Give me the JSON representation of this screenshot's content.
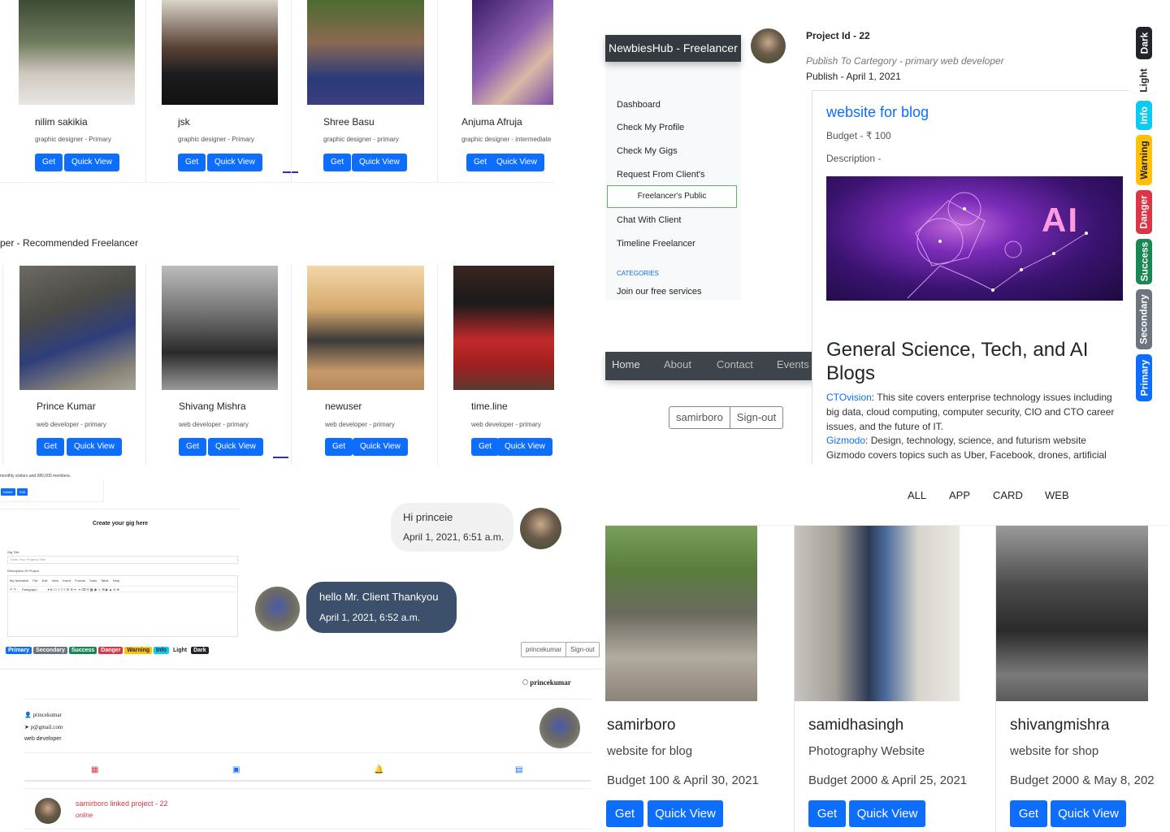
{
  "freelancers_top": [
    {
      "name": "nilim sakikia",
      "role": "graphic designer - Primary"
    },
    {
      "name": "jsk",
      "role": "graphic designer - Primary"
    },
    {
      "name": "Shree Basu",
      "role": "graphic designer - primary"
    },
    {
      "name": "Anjuma Afruja",
      "role": "graphic designer - intermediate"
    }
  ],
  "recommended_heading": "per - Recommended Freelancer",
  "freelancers_recommended": [
    {
      "name": "Prince Kumar",
      "role": "web developer - primary"
    },
    {
      "name": "Shivang Mishra",
      "role": "web developer - primary"
    },
    {
      "name": "newuser",
      "role": "web developer - primary"
    },
    {
      "name": "time.line",
      "role": "web developer - primary"
    }
  ],
  "card_buttons": {
    "get": "Get",
    "quick_view": "Quick View"
  },
  "sidebar": {
    "brand": "NewbiesHub - Freelancer",
    "items": [
      "Dashboard",
      "Check My Profile",
      "Check My Gigs",
      "Request From Client's",
      "Freelancer's Public",
      "Chat With Client",
      "Timeline Freelancer"
    ],
    "categories_label": "CATEGORIES",
    "categories_item": "Join our free services"
  },
  "topnav": {
    "items": [
      "Home",
      "About",
      "Contact",
      "Events"
    ]
  },
  "user_group": {
    "user": "samirboro",
    "signout": "Sign-out"
  },
  "project": {
    "id": "Project Id - 22",
    "category": "Publish To Cartegory - primary web developer",
    "publish": "Publish - April 1, 2021",
    "title": "website for blog",
    "budget": "Budget - ₹ 100",
    "description_label": "Description -",
    "image_text": "AI",
    "blog_heading": "General Science, Tech, and AI Blogs",
    "link1": "CTOvision",
    "text1": ": This site covers enterprise technology issues including big data, cloud computing, computer security, CIO and CTO career issues, and the future of IT.",
    "link2": "Gizmodo",
    "text2": ": Design, technology, science, and futurism website Gizmodo covers topics such as Uber, Facebook, drones, artificial intelligence,"
  },
  "theme_badges": [
    {
      "label": "Dark",
      "color": "#212529"
    },
    {
      "label": "Light",
      "color": "#ffffff"
    },
    {
      "label": "Info",
      "color": "#0dcaf0"
    },
    {
      "label": "Warning",
      "color": "#ffc107"
    },
    {
      "label": "Danger",
      "color": "#dc3545"
    },
    {
      "label": "Success",
      "color": "#198754"
    },
    {
      "label": "Secondary",
      "color": "#6c757d"
    },
    {
      "label": "Primary",
      "color": "#0d6efd"
    }
  ],
  "gig_editor": {
    "snippet": "monthly visitors and 680,000 members.",
    "delete": "Delete",
    "edit": "Edit",
    "title": "Create your gig here",
    "gig_title_label": "Gig Title",
    "gig_title_placeholder": "Enter Your Projects Title",
    "desc_label": "Description Of Project",
    "menu": [
      "My Newsfeet",
      "File",
      "Edit",
      "View",
      "Insert",
      "Format",
      "Tools",
      "Table",
      "Help"
    ],
    "paragraph": "Paragraph"
  },
  "small_badges": [
    {
      "label": "Primary",
      "color": "#0d6efd"
    },
    {
      "label": "Secondary",
      "color": "#6c757d"
    },
    {
      "label": "Success",
      "color": "#198754"
    },
    {
      "label": "Danger",
      "color": "#dc3545"
    },
    {
      "label": "Warning",
      "color": "#ffc107"
    },
    {
      "label": "Info",
      "color": "#0dcaf0"
    },
    {
      "label": "Light",
      "color": "#ffffff"
    },
    {
      "label": "Dark",
      "color": "#212529"
    }
  ],
  "chat": [
    {
      "text": "Hi princeie",
      "time": "April 1, 2021, 6:51 a.m."
    },
    {
      "text": "hello Mr. Client Thankyou",
      "time": "April 1, 2021, 6:52 a.m."
    }
  ],
  "profile": {
    "small_user": "princekumar",
    "small_signout": "Sign-out",
    "header_user": "princekumar",
    "username": "princekumar",
    "email": "p@gmail.com",
    "role": "web developer",
    "notification": "samirboro linked project - 22",
    "status": "online"
  },
  "filters": [
    "ALL",
    "APP",
    "CARD",
    "WEB"
  ],
  "projects": [
    {
      "user": "samirboro",
      "title": "website for blog",
      "budget": "Budget 100 & April 30, 2021"
    },
    {
      "user": "samidhasingh",
      "title": "Photography Website",
      "budget": "Budget 2000 & April 25, 2021"
    },
    {
      "user": "shivangmishra",
      "title": "website for shop",
      "budget": "Budget 2000 & May 8, 202"
    }
  ]
}
